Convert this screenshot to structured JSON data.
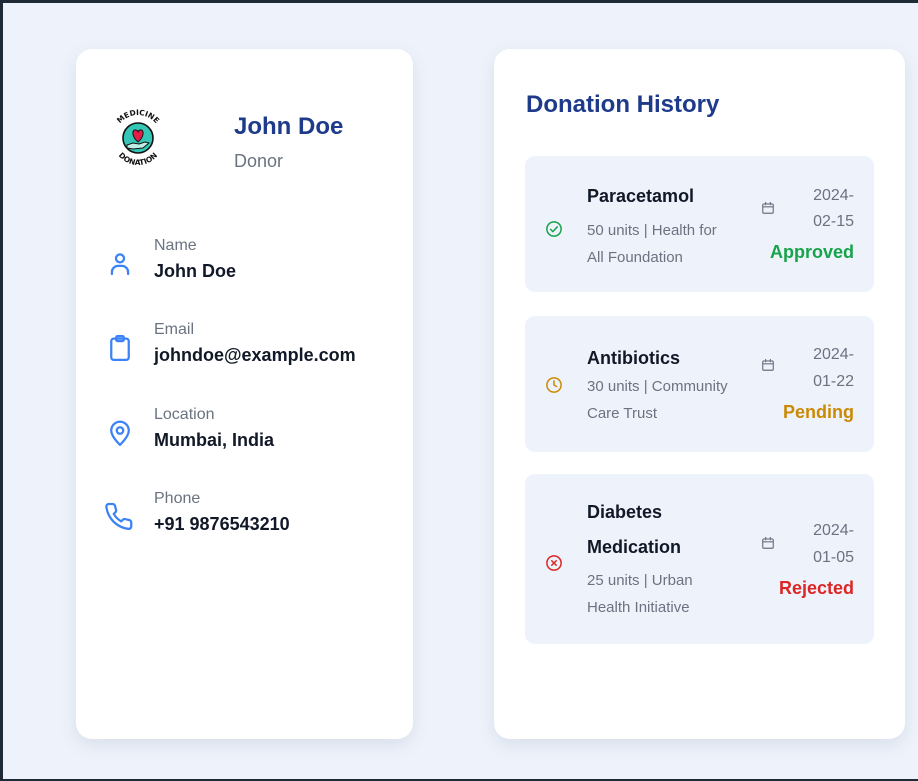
{
  "profile": {
    "name": "John Doe",
    "role": "Donor",
    "logo": {
      "top_text": "MEDICINE",
      "bottom_text": "DONATION"
    },
    "fields": [
      {
        "label": "Name",
        "value": "John Doe",
        "icon": "user-icon"
      },
      {
        "label": "Email",
        "value": "johndoe@example.com",
        "icon": "clipboard-icon"
      },
      {
        "label": "Location",
        "value": "Mumbai, India",
        "icon": "location-pin-icon"
      },
      {
        "label": "Phone",
        "value": "+91 9876543210",
        "icon": "phone-icon"
      }
    ]
  },
  "history": {
    "title": "Donation History",
    "items": [
      {
        "name": "Paracetamol",
        "desc_line1": "50 units | Health for",
        "desc_line2": "All Foundation",
        "date_line1": "2024-",
        "date_line2": "02-15",
        "status": "Approved",
        "status_icon": "check-circle-icon"
      },
      {
        "name": "Antibiotics",
        "desc_line1": "30 units | Community",
        "desc_line2": "Care Trust",
        "date_line1": "2024-",
        "date_line2": "01-22",
        "status": "Pending",
        "status_icon": "clock-icon"
      },
      {
        "name_line1": "Diabetes",
        "name_line2": "Medication",
        "desc_line1": "25 units | Urban",
        "desc_line2": "Health Initiative",
        "date_line1": "2024-",
        "date_line2": "01-05",
        "status": "Rejected",
        "status_icon": "x-circle-icon"
      }
    ]
  },
  "colors": {
    "page_bg": "#eef3fb",
    "card_bg": "#ffffff",
    "heading": "#1e3a8a",
    "icon_blue": "#3b82f6",
    "approved": "#16a34a",
    "pending": "#ca8a04",
    "rejected": "#dc2626",
    "item_bg": "#eef3fb"
  }
}
